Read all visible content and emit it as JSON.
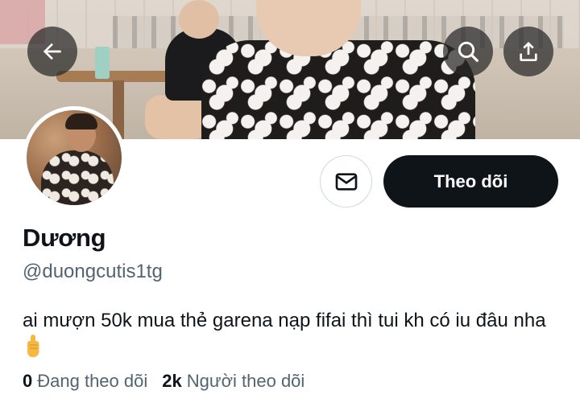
{
  "header": {
    "back_icon": "arrow-left-icon",
    "search_icon": "search-icon",
    "share_icon": "share-upload-icon"
  },
  "profile": {
    "display_name": "Dương",
    "handle": "@duongcutis1tg",
    "bio": "ai mượn 50k mua thẻ garena nạp fifai thì tui kh có iu đâu nha",
    "bio_emoji": "pointing-finger-emoji",
    "follow_button_label": "Theo dõi",
    "message_icon": "mail-icon"
  },
  "stats": {
    "following_count": "0",
    "following_label": "Đang theo dõi",
    "followers_count": "2k",
    "followers_label": "Người theo dõi"
  },
  "colors": {
    "primary_text": "#0f1419",
    "secondary_text": "#536471",
    "follow_button_bg": "#0f1419",
    "follow_button_text": "#ffffff",
    "border": "#cfd9de"
  }
}
